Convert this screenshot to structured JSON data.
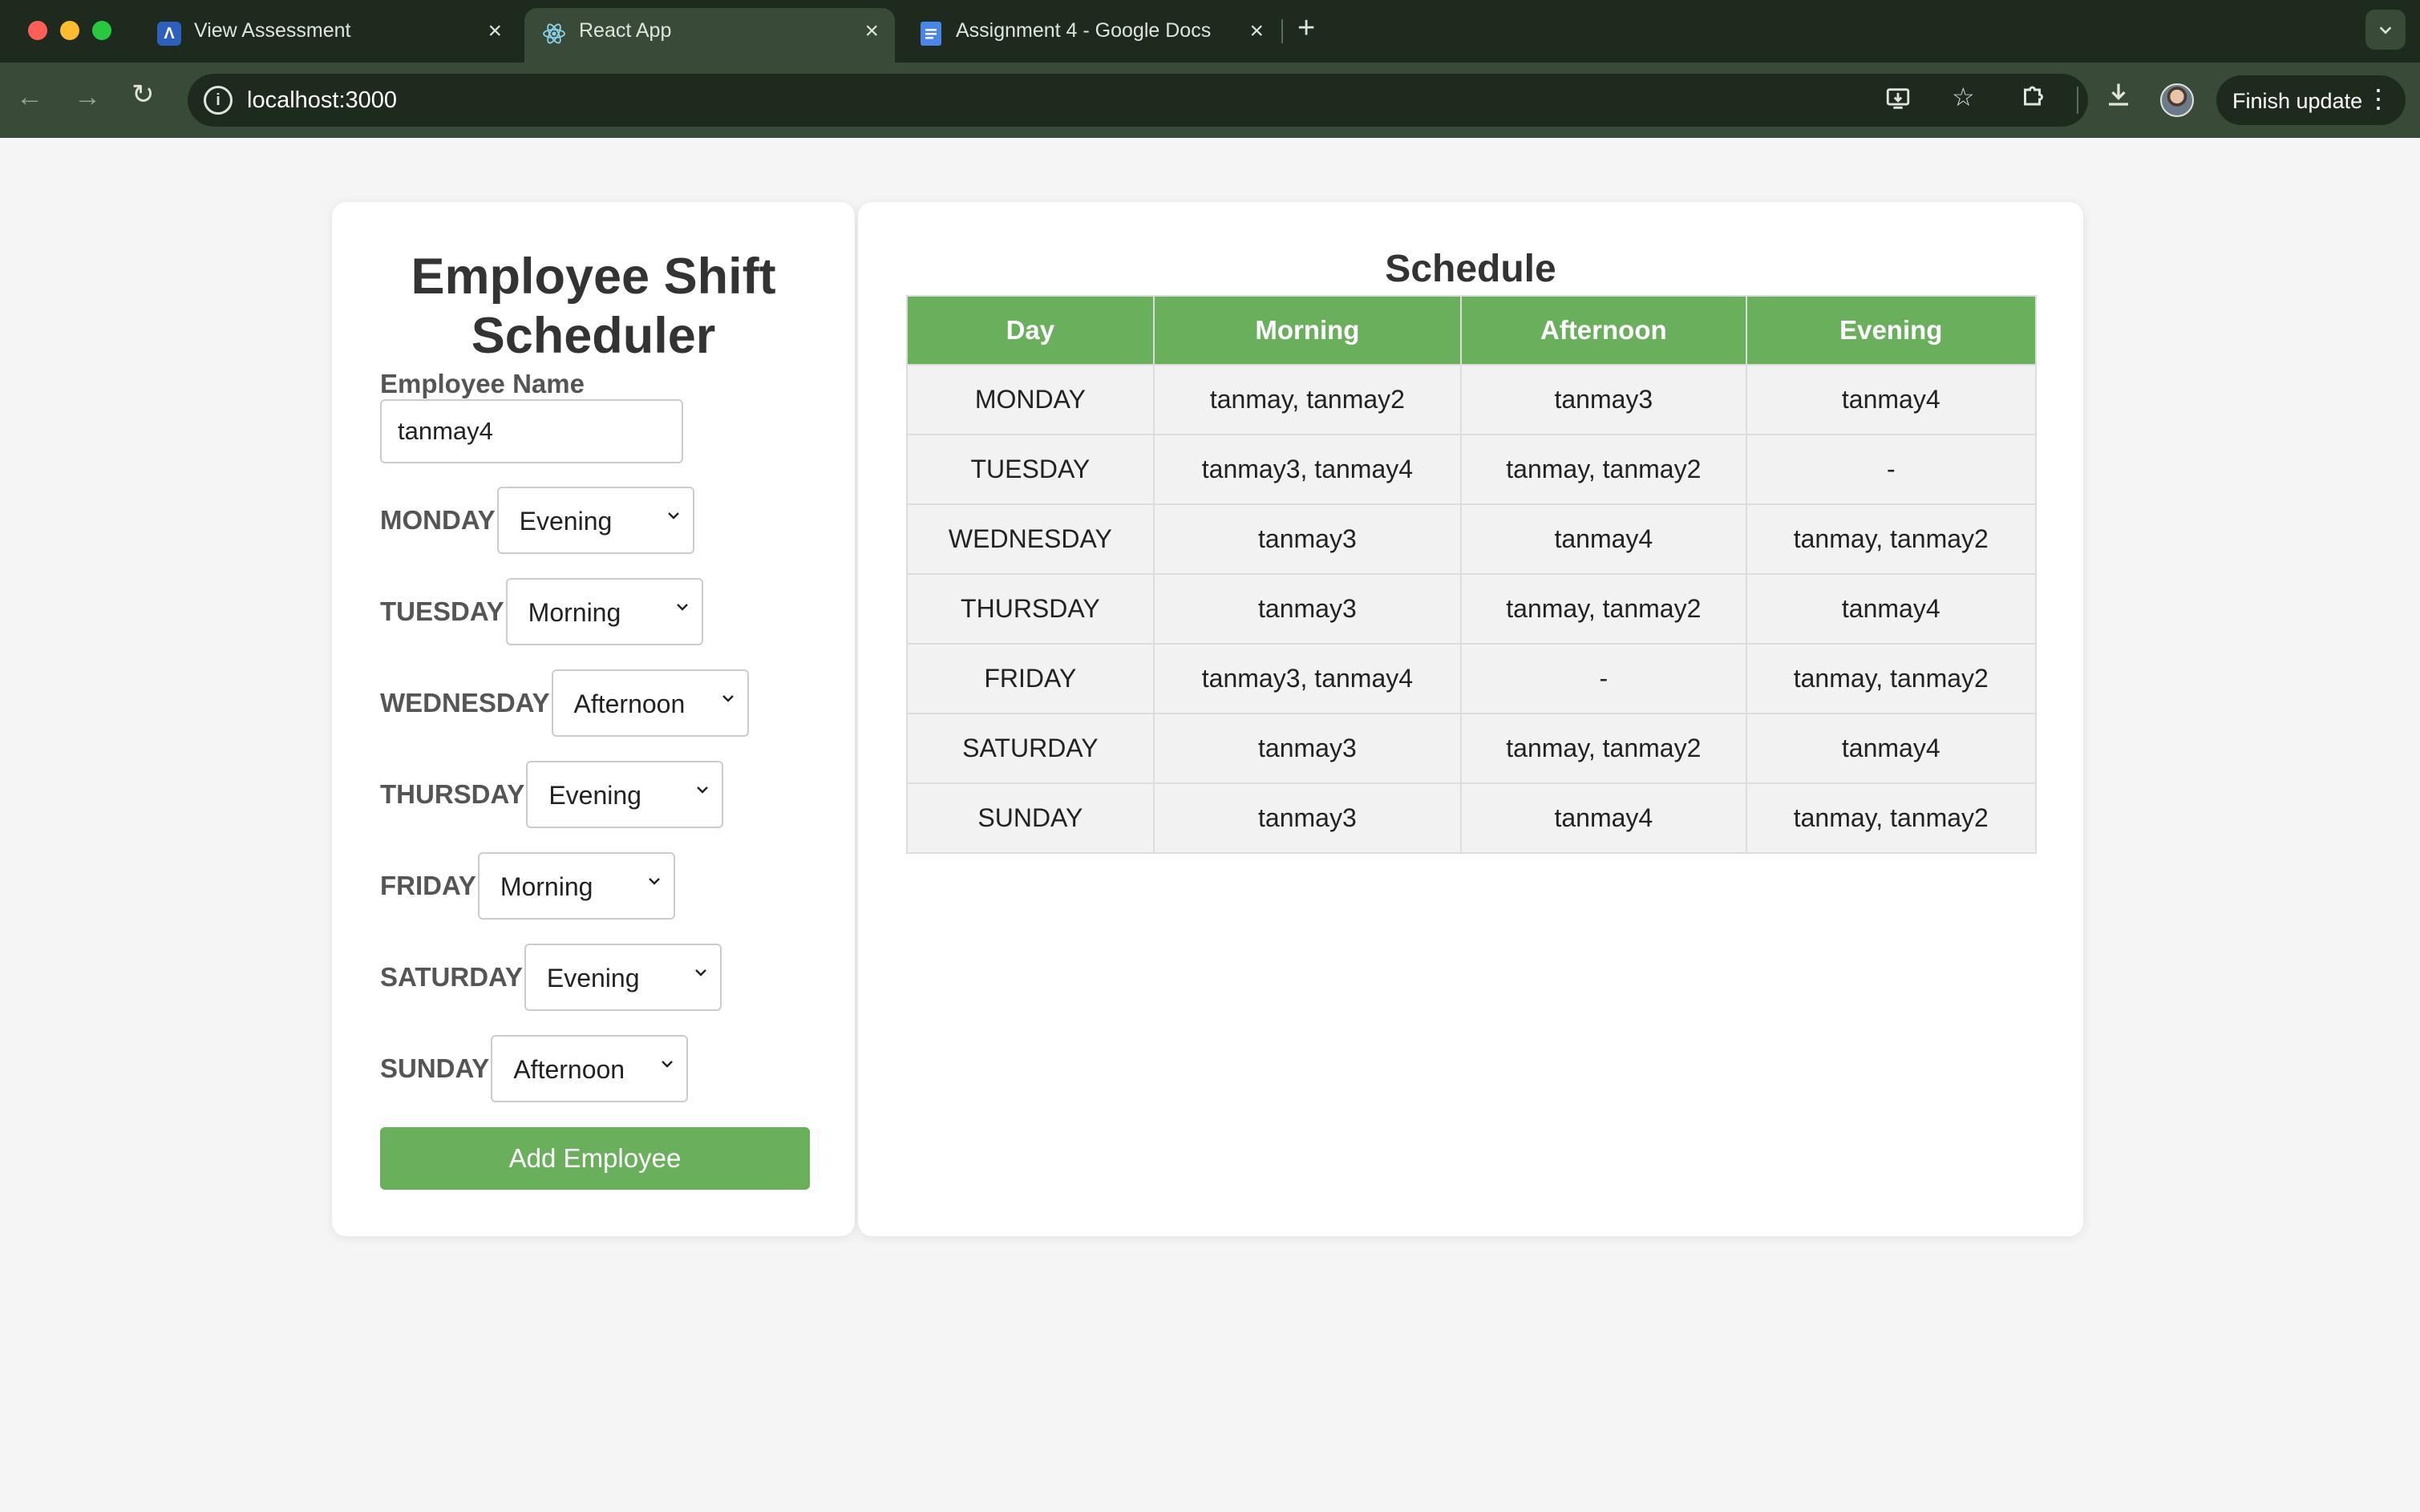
{
  "browser": {
    "tabs": [
      {
        "title": "View Assessment",
        "favicon": "assessment-logo-icon"
      },
      {
        "title": "React App",
        "favicon": "react-icon"
      },
      {
        "title": "Assignment 4 - Google Docs",
        "favicon": "google-docs-icon"
      }
    ],
    "url": "localhost:3000",
    "finish_update_label": "Finish update"
  },
  "form": {
    "title": "Employee Shift Scheduler",
    "name_label": "Employee Name",
    "name_value": "tanmay4",
    "days": [
      {
        "day": "MONDAY",
        "shift": "Evening"
      },
      {
        "day": "TUESDAY",
        "shift": "Morning"
      },
      {
        "day": "WEDNESDAY",
        "shift": "Afternoon"
      },
      {
        "day": "THURSDAY",
        "shift": "Evening"
      },
      {
        "day": "FRIDAY",
        "shift": "Morning"
      },
      {
        "day": "SATURDAY",
        "shift": "Evening"
      },
      {
        "day": "SUNDAY",
        "shift": "Afternoon"
      }
    ],
    "submit_label": "Add Employee"
  },
  "schedule": {
    "title": "Schedule",
    "headers": [
      "Day",
      "Morning",
      "Afternoon",
      "Evening"
    ],
    "rows": [
      [
        "MONDAY",
        "tanmay, tanmay2",
        "tanmay3",
        "tanmay4"
      ],
      [
        "TUESDAY",
        "tanmay3, tanmay4",
        "tanmay, tanmay2",
        "-"
      ],
      [
        "WEDNESDAY",
        "tanmay3",
        "tanmay4",
        "tanmay, tanmay2"
      ],
      [
        "THURSDAY",
        "tanmay3",
        "tanmay, tanmay2",
        "tanmay4"
      ],
      [
        "FRIDAY",
        "tanmay3, tanmay4",
        "-",
        "tanmay, tanmay2"
      ],
      [
        "SATURDAY",
        "tanmay3",
        "tanmay, tanmay2",
        "tanmay4"
      ],
      [
        "SUNDAY",
        "tanmay3",
        "tanmay4",
        "tanmay, tanmay2"
      ]
    ]
  },
  "colors": {
    "accent_green": "#6aaf5c",
    "chrome_dark": "#1f2a1f",
    "chrome_toolbar": "#3a4a38"
  }
}
